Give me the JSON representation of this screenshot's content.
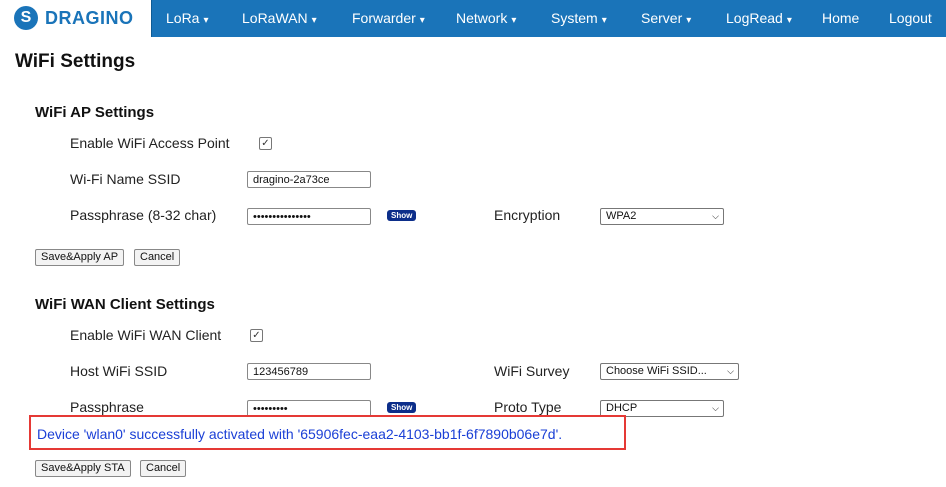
{
  "nav": {
    "logo_text": "DRAGINO",
    "items": [
      {
        "label": "LoRa",
        "caret": "▾"
      },
      {
        "label": "LoRaWAN",
        "caret": "▾"
      },
      {
        "label": "Forwarder",
        "caret": "▾"
      },
      {
        "label": "Network",
        "caret": "▾"
      },
      {
        "label": "System",
        "caret": "▾"
      },
      {
        "label": "Server",
        "caret": "▾"
      },
      {
        "label": "LogRead",
        "caret": "▾"
      },
      {
        "label": "Home",
        "caret": ""
      },
      {
        "label": "Logout",
        "caret": ""
      }
    ]
  },
  "page": {
    "title": "WiFi Settings"
  },
  "ap": {
    "title": "WiFi AP Settings",
    "enable_label": "Enable WiFi Access Point",
    "enable_checked": "✓",
    "ssid_label": "Wi-Fi Name SSID",
    "ssid_value": "dragino-2a73ce",
    "pass_label": "Passphrase (8-32 char)",
    "pass_value": "•••••••••••••••",
    "show_label": "Show",
    "enc_label": "Encryption",
    "enc_value": "WPA2",
    "save_label": "Save&Apply AP",
    "cancel_label": "Cancel"
  },
  "sta": {
    "title": "WiFi WAN Client Settings",
    "enable_label": "Enable WiFi WAN Client",
    "enable_checked": "✓",
    "ssid_label": "Host WiFi SSID",
    "ssid_value": "123456789",
    "survey_label": "WiFi Survey",
    "survey_value": "Choose WiFi SSID...",
    "pass_label": "Passphrase",
    "pass_value": "•••••••••",
    "show_label": "Show",
    "proto_label": "Proto Type",
    "proto_value": "DHCP",
    "save_label": "Save&Apply STA",
    "cancel_label": "Cancel"
  },
  "status": {
    "message": "Device 'wlan0' successfully activated with '65906fec-eaa2-4103-bb1f-6f7890b06e7d'."
  },
  "colors": {
    "nav_bg": "#1a74b9",
    "status_text": "#1a3fd6",
    "highlight_border": "#e53935",
    "show_button": "#0c2e8a"
  }
}
